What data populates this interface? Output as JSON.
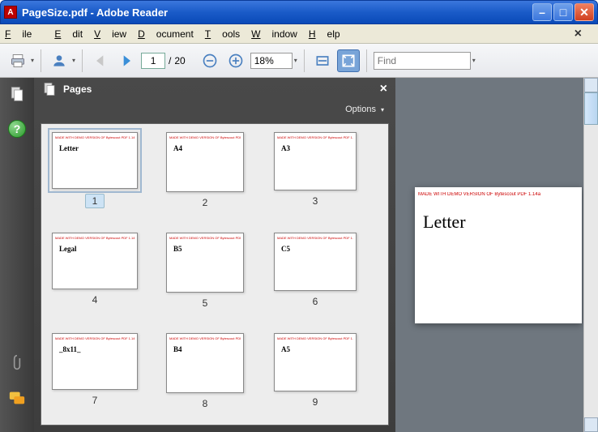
{
  "window": {
    "title": "PageSize.pdf - Adobe Reader",
    "app_icon_label": "A"
  },
  "menu": {
    "file": "File",
    "edit": "Edit",
    "view": "View",
    "document": "Document",
    "tools": "Tools",
    "window": "Window",
    "help": "Help"
  },
  "toolbar": {
    "current_page": "1",
    "page_sep": "/",
    "total_pages": "20",
    "zoom": "18%",
    "find_placeholder": "Find"
  },
  "panel": {
    "title": "Pages",
    "options_label": "Options"
  },
  "thumbs": [
    [
      {
        "label": "Letter",
        "num": "1",
        "sel": true,
        "cls": "t-letter"
      },
      {
        "label": "A4",
        "num": "2",
        "cls": "t-a4"
      },
      {
        "label": "A3",
        "num": "3",
        "cls": "t-a3"
      }
    ],
    [
      {
        "label": "Legal",
        "num": "4",
        "cls": "t-legal"
      },
      {
        "label": "B5",
        "num": "5",
        "cls": "t-b5"
      },
      {
        "label": "C5",
        "num": "6",
        "cls": "t-c5"
      }
    ],
    [
      {
        "label": "_8x11_",
        "num": "7",
        "cls": "t-8x11"
      },
      {
        "label": "B4",
        "num": "8",
        "cls": "t-b4"
      },
      {
        "label": "A5",
        "num": "9",
        "cls": "t-a5"
      }
    ]
  ],
  "demo_text": "MADE WITH DEMO VERSION OF Bytescout PDF 1.14a",
  "page_view": {
    "title": "Letter"
  }
}
